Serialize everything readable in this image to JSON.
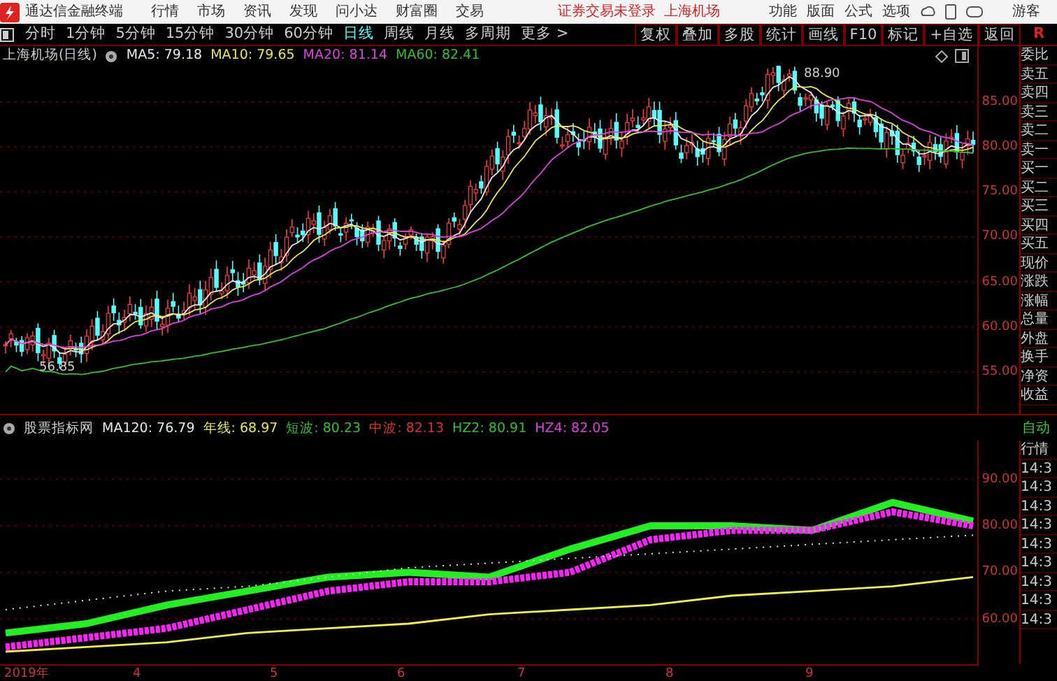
{
  "title_bar": {
    "app_name": "通达信金融终端",
    "menu": [
      "行情",
      "市场",
      "资讯",
      "发现",
      "问小达",
      "财富圈",
      "交易"
    ],
    "login_status": "证券交易未登录",
    "stock_name": "上海机场",
    "right_menu": [
      "功能",
      "版面",
      "公式",
      "选项"
    ],
    "user": "游客"
  },
  "period_tabs": [
    {
      "label": "分时",
      "selected": false
    },
    {
      "label": "1分钟",
      "selected": false
    },
    {
      "label": "5分钟",
      "selected": false
    },
    {
      "label": "15分钟",
      "selected": false
    },
    {
      "label": "30分钟",
      "selected": false
    },
    {
      "label": "60分钟",
      "selected": false
    },
    {
      "label": "日线",
      "selected": true
    },
    {
      "label": "周线",
      "selected": false
    },
    {
      "label": "月线",
      "selected": false
    },
    {
      "label": "多周期",
      "selected": false
    },
    {
      "label": "更多 >",
      "selected": false
    }
  ],
  "tool_buttons": [
    "复权",
    "叠加",
    "多股",
    "统计",
    "画线",
    "F10",
    "标记",
    "+自选",
    "返回"
  ],
  "r_label": "R",
  "price_chart": {
    "title": "上海机场(日线)",
    "indicators": [
      {
        "label": "MA5: 79.18",
        "color": "#e8e8e8"
      },
      {
        "label": "MA10: 79.65",
        "color": "#e8e850"
      },
      {
        "label": "MA20: 81.14",
        "color": "#e040e0"
      },
      {
        "label": "MA60: 82.41",
        "color": "#30c030"
      }
    ],
    "yticks": [
      "85.00",
      "80.00",
      "75.00",
      "70.00",
      "65.00",
      "60.00",
      "55.00"
    ],
    "high_label": "88.90",
    "low_label": "56.85"
  },
  "indicator_chart": {
    "title": "股票指标网",
    "indicators": [
      {
        "label": "MA120: 76.79",
        "color": "#e8e8e8"
      },
      {
        "label": "年线: 68.97",
        "color": "#e8e850"
      },
      {
        "label": "短波: 80.23",
        "color": "#30c030"
      },
      {
        "label": "中波: 82.13",
        "color": "#e03030"
      },
      {
        "label": "HZ2: 80.91",
        "color": "#30c030"
      },
      {
        "label": "HZ4: 82.05",
        "color": "#e040e0"
      }
    ],
    "chart_data": {
      "type": "line",
      "ylim": [
        50,
        98
      ],
      "grid": true,
      "yticks": [
        {
          "value": 90,
          "label": "90.00"
        },
        {
          "value": 80,
          "label": "80.00"
        },
        {
          "value": 70,
          "label": "70.00"
        },
        {
          "value": 60,
          "label": "60.00"
        }
      ],
      "series": [
        {
          "color": "#22ee22",
          "line_style": "solid",
          "values": [
            57,
            59,
            63,
            66,
            69,
            70,
            69,
            75,
            80,
            80,
            79,
            85,
            81
          ]
        },
        {
          "color": "#ff22ff",
          "line_style": "dashed",
          "values": [
            54,
            56,
            58,
            62,
            66,
            68,
            68,
            70,
            77,
            79,
            79,
            83,
            80
          ]
        },
        {
          "color": "#dddddd",
          "line_style": "dotted",
          "values": [
            62,
            64,
            66,
            67,
            69,
            71,
            72,
            73,
            74,
            75,
            76,
            77,
            78
          ]
        },
        {
          "color": "#f0f040",
          "line_style": "solid",
          "values": [
            53,
            54,
            55,
            57,
            58,
            59,
            61,
            62,
            63,
            65,
            66,
            67,
            69
          ]
        }
      ]
    }
  },
  "x_axis": [
    "2019年",
    "4",
    "5",
    "6",
    "7",
    "8",
    "9"
  ],
  "quote_panel": {
    "rows": [
      "委比",
      "卖五",
      "卖四",
      "卖三",
      "卖二",
      "卖一",
      "买一",
      "买二",
      "买三",
      "买四",
      "买五",
      "现价",
      "涨跌",
      "涨幅",
      "总量",
      "外盘",
      "换手",
      "净资",
      "收益"
    ],
    "mode": "自动",
    "tab": "行情",
    "times": [
      "14:3",
      "14:3",
      "14:3",
      "14:3",
      "14:3",
      "14:3",
      "14:3",
      "14:3",
      "14:3"
    ]
  }
}
